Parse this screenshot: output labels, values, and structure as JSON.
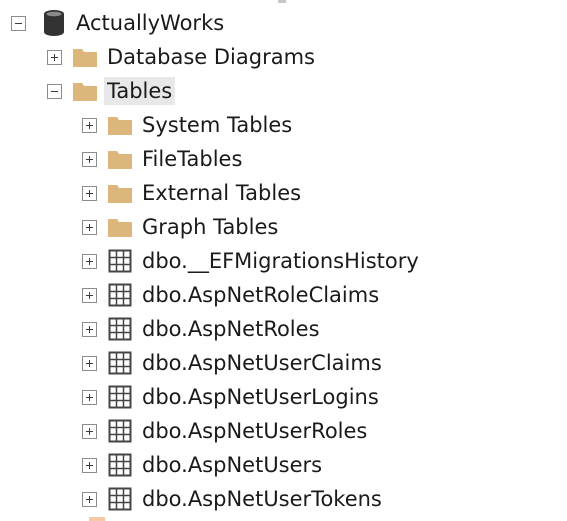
{
  "tree": {
    "database": {
      "label": "ActuallyWorks",
      "icon": "database-icon",
      "state": "expanded"
    },
    "database_diagrams": {
      "label": "Database Diagrams",
      "icon": "folder-icon",
      "state": "collapsed"
    },
    "tables": {
      "label": "Tables",
      "icon": "folder-icon",
      "state": "expanded",
      "selected": true
    },
    "table_folders": [
      {
        "label": "System Tables",
        "icon": "folder-icon"
      },
      {
        "label": "FileTables",
        "icon": "folder-icon"
      },
      {
        "label": "External Tables",
        "icon": "folder-icon"
      },
      {
        "label": "Graph Tables",
        "icon": "folder-icon"
      }
    ],
    "tables_list": [
      {
        "label": "dbo.__EFMigrationsHistory",
        "icon": "table-icon"
      },
      {
        "label": "dbo.AspNetRoleClaims",
        "icon": "table-icon"
      },
      {
        "label": "dbo.AspNetRoles",
        "icon": "table-icon"
      },
      {
        "label": "dbo.AspNetUserClaims",
        "icon": "table-icon"
      },
      {
        "label": "dbo.AspNetUserLogins",
        "icon": "table-icon"
      },
      {
        "label": "dbo.AspNetUserRoles",
        "icon": "table-icon"
      },
      {
        "label": "dbo.AspNetUsers",
        "icon": "table-icon"
      },
      {
        "label": "dbo.AspNetUserTokens",
        "icon": "table-icon"
      }
    ]
  },
  "colors": {
    "folder": "#dcb67a",
    "toggle_border": "#8c8c8c",
    "selection": "#e8e8e8",
    "table_grid": "#444444",
    "database": "#333333"
  }
}
